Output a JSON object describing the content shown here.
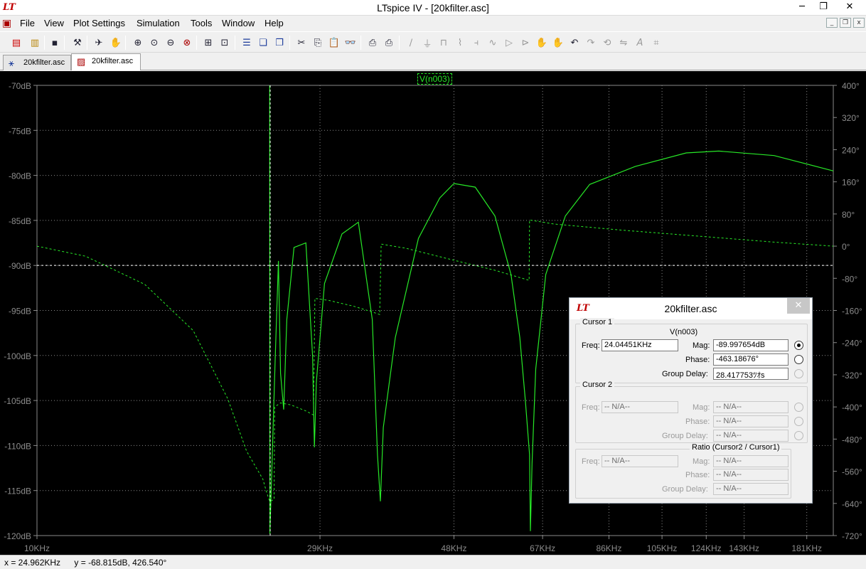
{
  "window": {
    "title": "LTspice IV - [20kfilter.asc]",
    "logo_text": "LT",
    "minimize": "─",
    "restore": "❐",
    "close": "✕"
  },
  "menu": {
    "items": [
      "File",
      "View",
      "Plot Settings",
      "Simulation",
      "Tools",
      "Window",
      "Help"
    ],
    "mdi_minimize": "_",
    "mdi_restore": "❐",
    "mdi_close": "x"
  },
  "tabs": [
    {
      "label": "20kfilter.asc",
      "icon": "schematic-icon"
    },
    {
      "label": "20kfilter.asc",
      "icon": "waveform-icon"
    }
  ],
  "plot": {
    "trace_label": "V(n003)",
    "left_axis_labels": [
      "-70dB",
      "-75dB",
      "-80dB",
      "-85dB",
      "-90dB",
      "-95dB",
      "-100dB",
      "-105dB",
      "-110dB",
      "-115dB",
      "-120dB"
    ],
    "right_axis_labels": [
      "400°",
      "320°",
      "240°",
      "160°",
      "80°",
      "0°",
      "-80°",
      "-160°",
      "-240°",
      "-320°",
      "-400°",
      "-480°",
      "-560°",
      "-640°",
      "-720°"
    ],
    "x_axis_labels": [
      "10KHz",
      "29KHz",
      "48KHz",
      "67KHz",
      "86KHz",
      "105KHz",
      "124KHz",
      "143KHz",
      "181KHz"
    ],
    "trace_color": "#27e827",
    "grid_color": "#8a8a8a",
    "background": "#000000"
  },
  "chart_data": {
    "type": "line",
    "title": "V(n003)",
    "x_scale": "log",
    "xlim_hz": [
      10000,
      200000
    ],
    "ylim_db": [
      -120,
      -70
    ],
    "y2lim_deg": [
      -720,
      400
    ],
    "series": [
      {
        "name": "V(n003)",
        "style": "solid",
        "axis": "magnitude_dB",
        "x_khz": [
          24.0,
          24.02,
          24.5,
          24.8,
          25.0,
          25.3,
          25.6,
          26.3,
          27.5,
          28.2,
          28.4,
          28.6,
          29.5,
          31.5,
          33.5,
          35.3,
          36.0,
          36.4,
          36.8,
          38.5,
          42.0,
          45.5,
          48.0,
          52.0,
          56.0,
          59.5,
          61.5,
          62.8,
          63.8,
          64.0,
          64.4,
          65.3,
          67.8,
          73.0,
          80.0,
          95.0,
          115.0,
          130.0,
          160.0,
          200.0
        ],
        "values_db": [
          -70,
          -119.8,
          -100.5,
          -89.5,
          -102,
          -106,
          -96,
          -88,
          -87.5,
          -100,
          -110.2,
          -103,
          -92,
          -86.5,
          -85.2,
          -96,
          -111,
          -116.2,
          -108,
          -98,
          -87,
          -82.5,
          -80.9,
          -81.3,
          -84.5,
          -91,
          -98,
          -105,
          -111,
          -119.5,
          -112,
          -101.5,
          -91,
          -84.5,
          -81,
          -79,
          -77.5,
          -77.3,
          -77.8,
          -79.5
        ]
      },
      {
        "name": "V(n003)",
        "style": "dashed",
        "axis": "phase_deg",
        "x_khz": [
          10.0,
          12.0,
          15.0,
          18.0,
          20.5,
          22.0,
          23.4,
          23.7,
          24.0,
          24.4,
          24.45,
          25.0,
          26.0,
          27.5,
          28.3,
          28.45,
          30.0,
          33.0,
          35.5,
          36.3,
          36.5,
          40.0,
          48.0,
          56.0,
          63.7,
          63.8,
          70.0,
          90.0,
          120.0,
          160.0,
          200.0
        ],
        "values_deg": [
          0,
          -25,
          -95,
          -210,
          -380,
          -510,
          -580,
          -610,
          -635,
          -630,
          -400,
          -390,
          -395,
          -410,
          -420,
          -130,
          -135,
          -150,
          -165,
          -170,
          5,
          -5,
          -35,
          -60,
          -85,
          65,
          55,
          40,
          25,
          10,
          0
        ]
      }
    ],
    "cursor": {
      "x_khz": 24.04451,
      "y_db": -89.997654
    }
  },
  "cursor_window": {
    "title": "20kfilter.asc",
    "close": "✕",
    "cursor1": {
      "legend": "Cursor 1",
      "trace": "V(n003)",
      "freq_label": "Freq:",
      "freq_value": "24.04451KHz",
      "mag_label": "Mag:",
      "mag_value": "-89.997654dB",
      "phase_label": "Phase:",
      "phase_value": "-463.18676°",
      "gd_label": "Group Delay:",
      "gd_value": "28.417753ﾂｵs"
    },
    "cursor2": {
      "legend": "Cursor 2",
      "freq_label": "Freq:",
      "freq_value": "-- N/A--",
      "mag_label": "Mag:",
      "mag_value": "-- N/A--",
      "phase_label": "Phase:",
      "phase_value": "-- N/A--",
      "gd_label": "Group Delay:",
      "gd_value": "-- N/A--"
    },
    "ratio": {
      "legend": "Ratio (Cursor2 / Cursor1)",
      "freq_label": "Freq:",
      "freq_value": "-- N/A--",
      "mag_label": "Mag:",
      "mag_value": "-- N/A--",
      "phase_label": "Phase:",
      "phase_value": "-- N/A--",
      "gd_label": "Group Delay:",
      "gd_value": "-- N/A--"
    }
  },
  "status": {
    "x": "x = 24.962KHz",
    "y": "y = -68.815dB, 426.540°"
  }
}
